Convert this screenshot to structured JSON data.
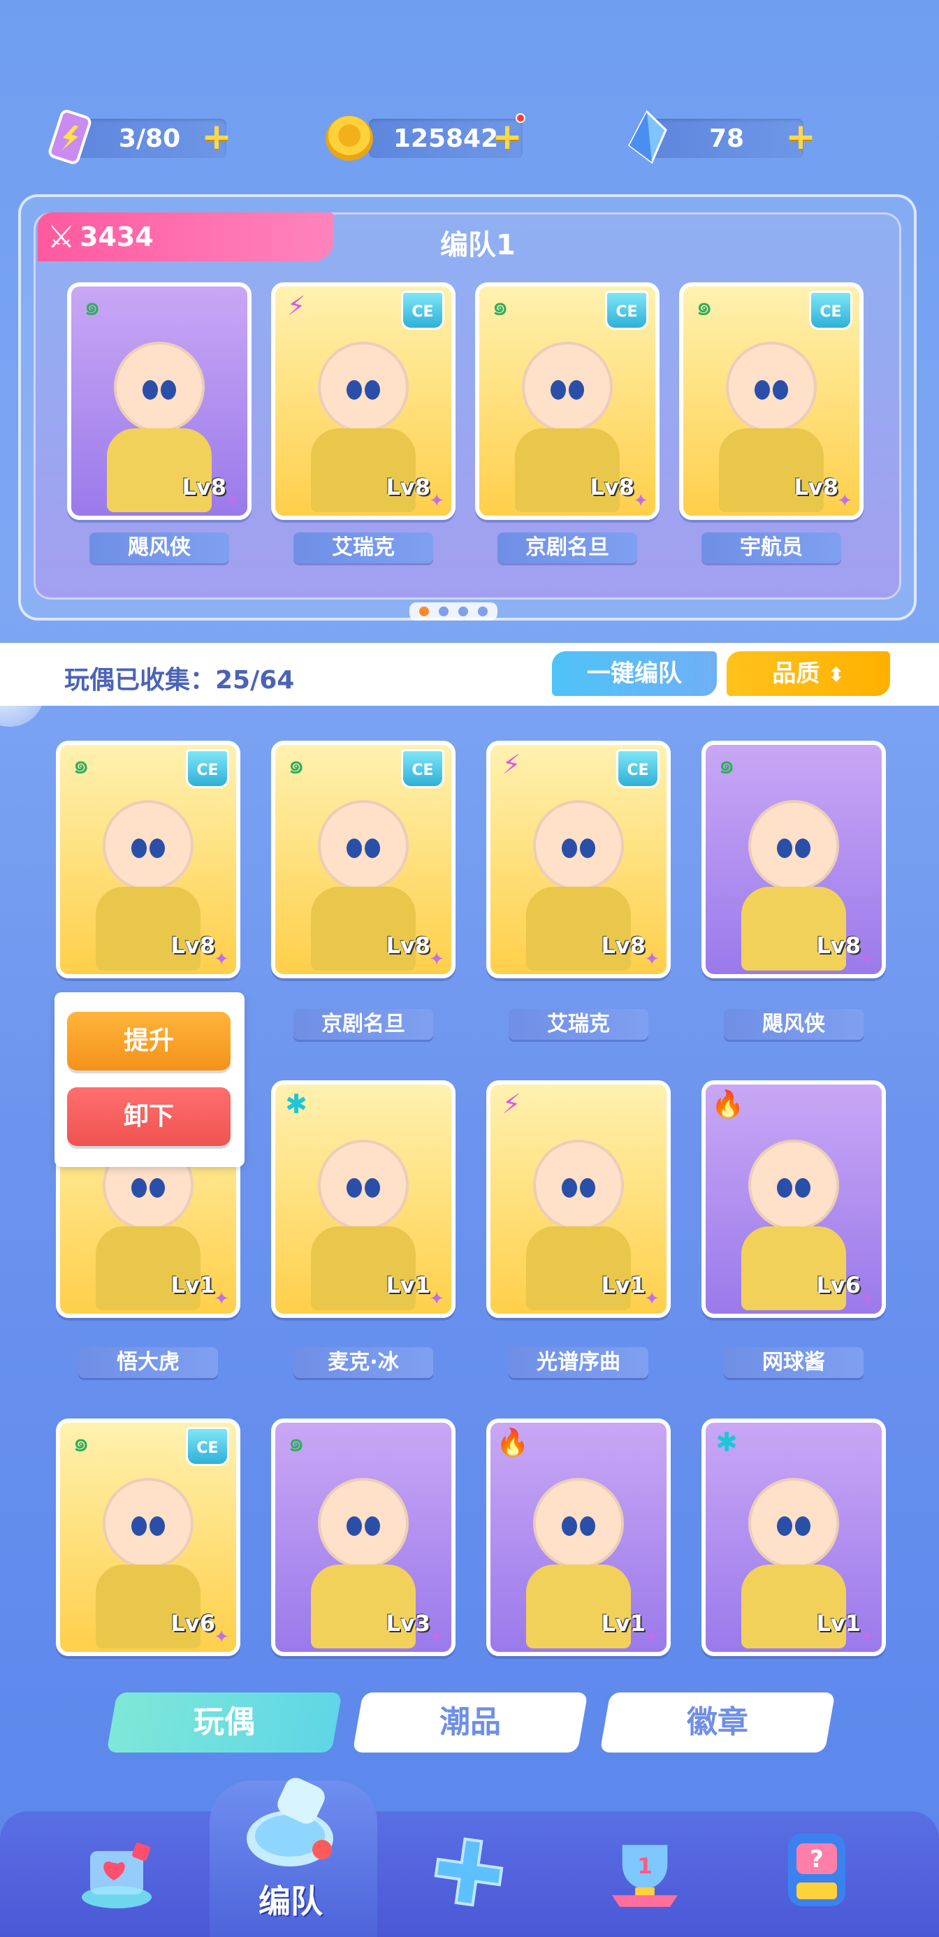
{
  "resources": {
    "stamina": {
      "value": "3/80",
      "icon": "stamina-battery-icon"
    },
    "coins": {
      "value": "125842",
      "icon": "gold-coin-icon"
    },
    "crystals": {
      "value": "78",
      "icon": "crystal-icon"
    },
    "plus": "+"
  },
  "team": {
    "power": "3434",
    "title": "编队1",
    "members": [
      {
        "name": "飓风侠",
        "level": "Lv8",
        "element": "wind",
        "ce": false
      },
      {
        "name": "艾瑞克",
        "level": "Lv8",
        "element": "lightning",
        "ce": true
      },
      {
        "name": "京剧名旦",
        "level": "Lv8",
        "element": "wind",
        "ce": true
      },
      {
        "name": "宇航员",
        "level": "Lv8",
        "element": "wind",
        "ce": true
      }
    ],
    "pages": 4,
    "active_page": 0
  },
  "collection": {
    "label": "玩偶已收集：25/64",
    "one_key_team": "一键编队",
    "quality": "品质"
  },
  "dolls": [
    {
      "name": "",
      "level": "Lv8",
      "element": "wind",
      "ce": true,
      "bg": "yellow"
    },
    {
      "name": "京剧名旦",
      "level": "Lv8",
      "element": "wind",
      "ce": true,
      "bg": "yellow"
    },
    {
      "name": "艾瑞克",
      "level": "Lv8",
      "element": "lightning",
      "ce": true,
      "bg": "yellow"
    },
    {
      "name": "飓风侠",
      "level": "Lv8",
      "element": "wind",
      "ce": false,
      "bg": "purple"
    },
    {
      "name": "悟大虎",
      "level": "Lv1",
      "element": "",
      "ce": false,
      "bg": "yellow"
    },
    {
      "name": "麦克·冰",
      "level": "Lv1",
      "element": "ice",
      "ce": false,
      "bg": "yellow"
    },
    {
      "name": "光谱序曲",
      "level": "Lv1",
      "element": "lightning",
      "ce": false,
      "bg": "yellow"
    },
    {
      "name": "网球酱",
      "level": "Lv6",
      "element": "fire",
      "ce": false,
      "bg": "purple"
    },
    {
      "name": "",
      "level": "Lv6",
      "element": "wind",
      "ce": true,
      "bg": "yellow"
    },
    {
      "name": "",
      "level": "Lv3",
      "element": "wind",
      "ce": false,
      "bg": "purple"
    },
    {
      "name": "",
      "level": "Lv1",
      "element": "fire",
      "ce": false,
      "bg": "purple"
    },
    {
      "name": "",
      "level": "Lv1",
      "element": "ice",
      "ce": false,
      "bg": "purple"
    }
  ],
  "popup": {
    "upgrade": "提升",
    "remove": "卸下"
  },
  "tabs": [
    {
      "label": "玩偶",
      "active": true
    },
    {
      "label": "潮品",
      "active": false
    },
    {
      "label": "徽章",
      "active": false
    }
  ],
  "bottom_nav": {
    "active_label": "编队",
    "items": [
      "shop-icon",
      "team-whistle-icon",
      "gamepad-icon",
      "trophy-icon",
      "gacha-machine-icon"
    ]
  },
  "ce_text": "CE",
  "element_glyphs": {
    "wind": "๑",
    "lightning": "⚡",
    "ice": "✱",
    "fire": "🔥"
  },
  "colors": {
    "accent_pink": "#ff5a9f",
    "accent_yellow": "#ffb000",
    "accent_cyan": "#4fc3f7"
  }
}
